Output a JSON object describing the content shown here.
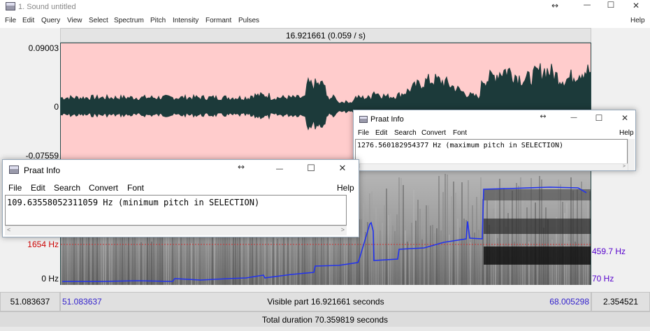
{
  "window": {
    "title": "1. Sound untitled",
    "resize_glyph": "↔",
    "minimize": "—",
    "maximize": "☐",
    "close": "✕"
  },
  "menu": {
    "items": [
      "File",
      "Edit",
      "Query",
      "View",
      "Select",
      "Spectrum",
      "Pitch",
      "Intensity",
      "Formant",
      "Pulses"
    ],
    "help": "Help"
  },
  "editor": {
    "time_header": "16.921661 (0.059 / s)",
    "wave_max": "0.09003",
    "wave_zero": "0",
    "wave_min": "-0.07559",
    "spec_max_label": "1654 Hz",
    "spec_min_label": "0 Hz",
    "pitch_max_label": "459.7 Hz",
    "pitch_min_label": "70 Hz",
    "left_time": "51.083637",
    "visible_start": "51.083637",
    "visible_label": "Visible part 16.921661 seconds",
    "visible_end": "68.005298",
    "right_time": "2.354521",
    "total_label": "Total duration 70.359819 seconds"
  },
  "info_windows": [
    {
      "title": "Praat Info",
      "menu": [
        "File",
        "Edit",
        "Search",
        "Convert",
        "Font"
      ],
      "help": "Help",
      "text": "109.63558052311059 Hz (minimum pitch in SELECTION)"
    },
    {
      "title": "Praat Info",
      "menu": [
        "File",
        "Edit",
        "Search",
        "Convert",
        "Font"
      ],
      "help": "Help",
      "text": "1276.560182954377 Hz (maximum pitch in SELECTION)"
    }
  ],
  "colors": {
    "waveform_bg": "#ffcccc",
    "waveform": "#1c3a3a",
    "pitch": "#2233ee",
    "spec_max_label": "#cc0000",
    "pitch_axis": "#5500cc",
    "time_link": "#3322cc"
  },
  "icons": {
    "app": "praat-sound-icon",
    "scroll_left": "◀",
    "scroll_right": "▶",
    "scroll_left_small": "<",
    "scroll_right_small": ">"
  }
}
